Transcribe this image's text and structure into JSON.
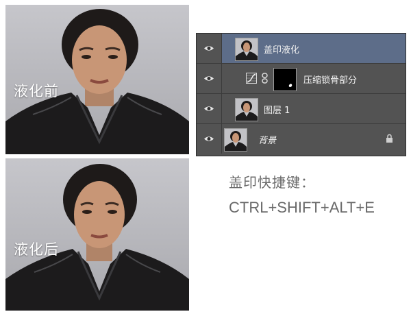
{
  "photos": {
    "before_label": "液化前",
    "after_label": "液化后"
  },
  "layers_panel": {
    "layers": [
      {
        "name": "盖印液化",
        "selected": true,
        "visible": true,
        "thumbnail": "portrait"
      },
      {
        "name": "压缩锁骨部分",
        "selected": false,
        "visible": true,
        "thumbnail": "black-mask",
        "adjustment": "curves-adjustment",
        "linked": true
      },
      {
        "name": "图层 1",
        "selected": false,
        "visible": true,
        "thumbnail": "portrait"
      },
      {
        "name": "背景",
        "selected": false,
        "visible": true,
        "thumbnail": "portrait",
        "locked": true
      }
    ],
    "selection_color": "#5d6d89",
    "panel_color": "#535353"
  },
  "shortcut": {
    "title": "盖印快捷键：",
    "keys": "CTRL+SHIFT+ALT+E"
  }
}
